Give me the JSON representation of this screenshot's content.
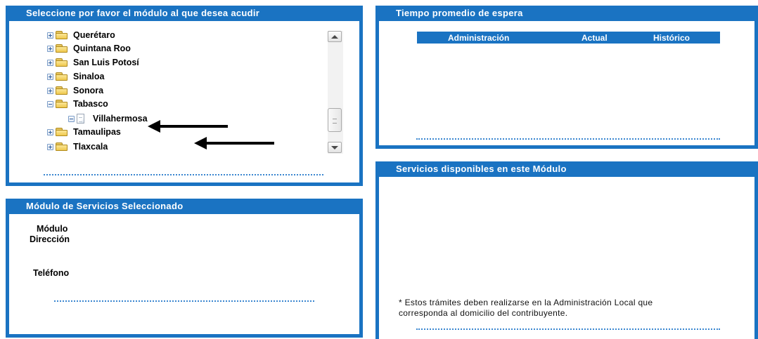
{
  "module_selector": {
    "title": "Seleccione por favor el módulo al que desea acudir",
    "tree": [
      {
        "label": "Querétaro",
        "type": "folder",
        "expanded": false
      },
      {
        "label": "Quintana Roo",
        "type": "folder",
        "expanded": false
      },
      {
        "label": "San Luis Potosí",
        "type": "folder",
        "expanded": false
      },
      {
        "label": "Sinaloa",
        "type": "folder",
        "expanded": false
      },
      {
        "label": "Sonora",
        "type": "folder",
        "expanded": false
      },
      {
        "label": "Tabasco",
        "type": "folder",
        "expanded": true
      },
      {
        "label": "Villahermosa",
        "type": "document",
        "expanded": true
      },
      {
        "label": "Tamaulipas",
        "type": "folder",
        "expanded": false
      },
      {
        "label": "Tlaxcala",
        "type": "folder",
        "expanded": false
      }
    ],
    "icons": {
      "expand": "plus-box-icon",
      "collapse": "minus-box-icon",
      "folder": "folder-icon",
      "document": "document-icon"
    }
  },
  "selected_module": {
    "title": "Módulo de Servicios Seleccionado",
    "module_label": "Módulo",
    "address_label": "Dirección",
    "phone_label": "Teléfono"
  },
  "wait_time": {
    "title": "Tiempo promedio de espera",
    "columns": [
      "Administración",
      "Actual",
      "Histórico"
    ]
  },
  "services": {
    "title": "Servicios disponibles en este Módulo",
    "note_line1": "* Estos trámites deben realizarse en la Administración Local que",
    "note_line2": "corresponda al domicilio del contribuyente."
  },
  "colors": {
    "accent": "#1a73c2",
    "annotation_arrow": "#000000"
  }
}
